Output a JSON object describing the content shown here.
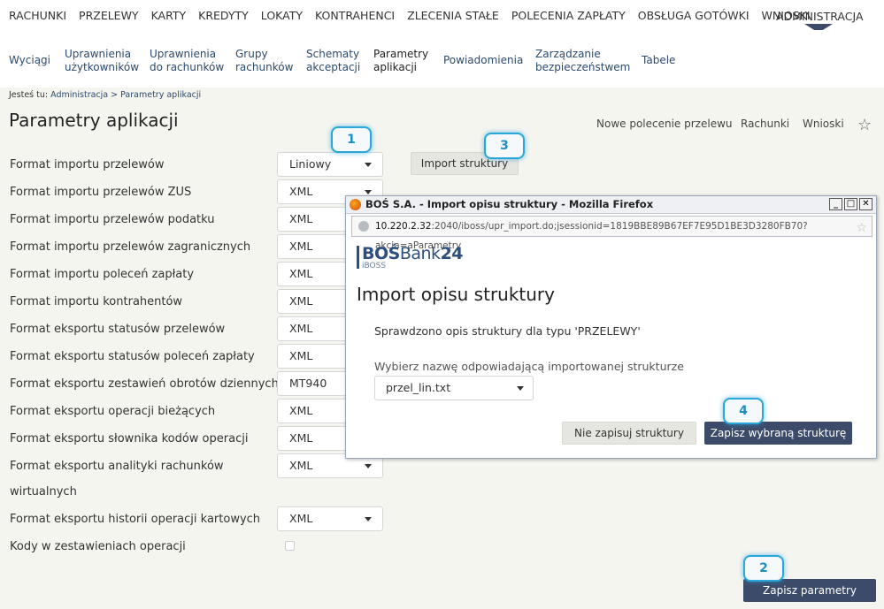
{
  "topnav": [
    "RACHUNKI",
    "PRZELEWY",
    "KARTY",
    "KREDYTY",
    "LOKATY",
    "KONTRAHENCI",
    "ZLECENIA STAŁE",
    "POLECENIA ZAPŁATY",
    "OBSŁUGA GOTÓWKI",
    "WNIOSKI"
  ],
  "topnav_active": "ADMINISTRACJA",
  "subnav": [
    {
      "line1": "Wyciągi",
      "line2": ""
    },
    {
      "line1": "Uprawnienia",
      "line2": "użytkowników"
    },
    {
      "line1": "Uprawnienia",
      "line2": "do rachunków"
    },
    {
      "line1": "Grupy",
      "line2": "rachunków"
    },
    {
      "line1": "Schematy",
      "line2": "akceptacji"
    },
    {
      "line1": "Parametry",
      "line2": "aplikacji"
    },
    {
      "line1": "Powiadomienia",
      "line2": ""
    },
    {
      "line1": "Zarządzanie",
      "line2": "bezpieczeństwem"
    },
    {
      "line1": "Tabele",
      "line2": ""
    }
  ],
  "breadcrumb": {
    "prefix": "Jesteś tu:",
    "path": "Administracja > Parametry aplikacji"
  },
  "page_title": "Parametry aplikacji",
  "quicklinks": [
    "Nowe polecenie przelewu",
    "Rachunki",
    "Wnioski"
  ],
  "rows": [
    {
      "label": "Format importu przelewów",
      "value": "Liniowy"
    },
    {
      "label": "Format importu przelewów ZUS",
      "value": "XML"
    },
    {
      "label": "Format importu przelewów podatku",
      "value": "XML"
    },
    {
      "label": "Format importu przelewów zagranicznych",
      "value": "XML"
    },
    {
      "label": "Format importu poleceń zapłaty",
      "value": "XML"
    },
    {
      "label": "Format importu kontrahentów",
      "value": "XML"
    },
    {
      "label": "Format eksportu statusów przelewów",
      "value": "XML"
    },
    {
      "label": "Format eksportu statusów poleceń zapłaty",
      "value": "XML"
    },
    {
      "label": "Format eksportu zestawień obrotów dziennych",
      "value": "MT940"
    },
    {
      "label": "Format eksportu operacji bieżących",
      "value": "XML"
    },
    {
      "label": "Format eksportu słownika kodów operacji",
      "value": "XML"
    },
    {
      "label": "Format eksportu analityki rachunków",
      "label2": "wirtualnych",
      "value": "XML"
    },
    {
      "label": "Format eksportu historii operacji kartowych",
      "value": "XML"
    }
  ],
  "checkbox_label": "Kody w zestawieniach operacji",
  "buttons": {
    "import": "Import struktury",
    "save_params": "Zapisz parametry"
  },
  "badges": [
    "1",
    "2",
    "3",
    "4"
  ],
  "popup": {
    "window_title": "BOŚ S.A. - Import opisu struktury - Mozilla Firefox",
    "url_host": "10.220.2.32",
    "url_rest": ":2040/iboss/upr_import.do;jsessionid=1819BBE89B67EF7E95D1BE3D3280FB70?akcja=aParametry",
    "logo_main": "BOŚ",
    "logo_bank": "Bank",
    "logo_num": "24",
    "logo_sub": "iBOSS",
    "heading": "Import opisu struktury",
    "info": "Sprawdzono opis struktury dla typu 'PRZELEWY'",
    "choose_label": "Wybierz nazwę odpowiadającą importowanej strukturze",
    "select_value": "przel_lin.txt",
    "btn_nosave": "Nie zapisuj struktury",
    "btn_save": "Zapisz wybraną strukturę"
  }
}
